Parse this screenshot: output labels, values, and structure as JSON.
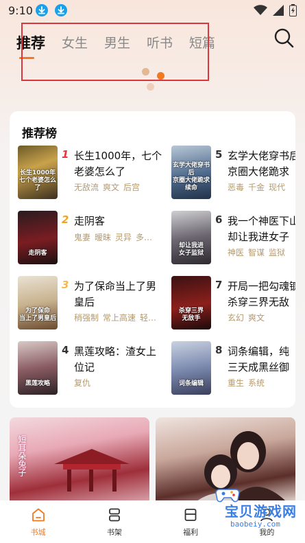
{
  "status_bar": {
    "time": "9:10"
  },
  "top_tabs": [
    {
      "label": "推荐",
      "active": true
    },
    {
      "label": "女生",
      "active": false
    },
    {
      "label": "男生",
      "active": false
    },
    {
      "label": "听书",
      "active": false
    },
    {
      "label": "短篇",
      "active": false
    }
  ],
  "colors": {
    "accent": "#f2791e",
    "tag": "#b59a6d",
    "annotation": "#d9363e",
    "rank1": "#e8343a",
    "rank2": "#f2a31e",
    "rank3": "#f5b84d"
  },
  "ranking": {
    "title": "推荐榜",
    "items": [
      {
        "rank": "1",
        "title": "长生1000年，七个老婆怎么了",
        "tags": [
          "无敌流",
          "爽文",
          "后宫"
        ],
        "cover_text": "长生1000年\n七个老婆怎么了"
      },
      {
        "rank": "2",
        "title": "走阴客",
        "tags": [
          "鬼妻",
          "暧昧",
          "灵异",
          "多…"
        ],
        "cover_text": "走阴客"
      },
      {
        "rank": "3",
        "title": "为了保命当上了男皇后",
        "tags": [
          "稍强制",
          "常上高速",
          "轻…"
        ],
        "cover_text": "为了保命\n当上了男皇后"
      },
      {
        "rank": "4",
        "title": "黑莲攻略：渣女上位记",
        "tags": [
          "复仇"
        ],
        "cover_text": "黑莲攻略"
      },
      {
        "rank": "5",
        "title": "玄学大佬穿书后",
        "title2": "京圈大佬跪求",
        "tags": [
          "恶毒",
          "千金",
          "现代"
        ],
        "cover_text": "玄学大佬穿书后\n京圈大佬跪求续命"
      },
      {
        "rank": "6",
        "title": "我一个神医下山",
        "title2": "却让我进女子",
        "tags": [
          "神医",
          "智谋",
          "监狱"
        ],
        "cover_text": "却让我进\n女子监狱"
      },
      {
        "rank": "7",
        "title": "开局一把勾魂镰",
        "title2": "杀穿三界无敌",
        "tags": [
          "玄幻",
          "爽文"
        ],
        "cover_text": "杀穿三界\n无敌手"
      },
      {
        "rank": "8",
        "title": "词条编辑，纯",
        "title2": "三天成黑丝御",
        "tags": [
          "重生",
          "系统"
        ],
        "cover_text": "词条编辑"
      }
    ]
  },
  "banners": [
    {
      "text": "短耳朵兔子"
    },
    {
      "text": ""
    }
  ],
  "bottom_nav": [
    {
      "label": "书城",
      "active": true,
      "icon": "home-icon"
    },
    {
      "label": "书架",
      "active": false,
      "icon": "bookshelf-icon"
    },
    {
      "label": "福利",
      "active": false,
      "icon": "gift-icon"
    },
    {
      "label": "我的",
      "active": false,
      "icon": "user-icon"
    }
  ],
  "watermark": {
    "text": "宝贝游戏网",
    "url": "baobeiy.com"
  }
}
